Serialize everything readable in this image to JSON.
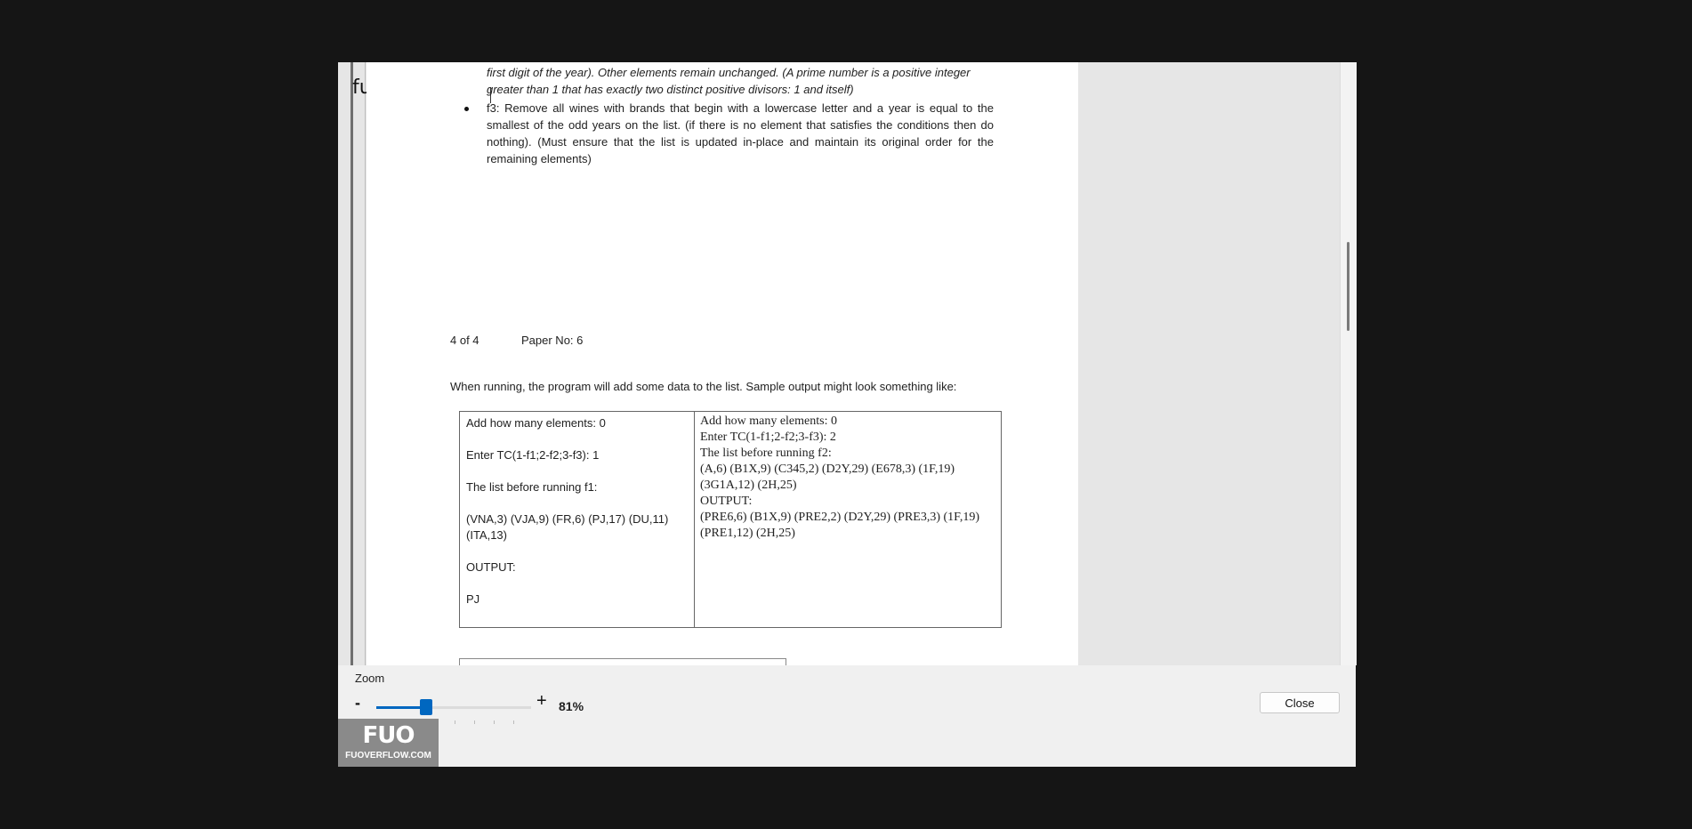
{
  "brand": {
    "watermark": "fuoverflow"
  },
  "document": {
    "italic_line_1": "first digit of the year). Other elements remain unchanged. (A prime number is a positive integer",
    "italic_line_2": "greater than 1 that has exactly two distinct positive divisors: 1 and itself)",
    "bullet_f3": "f3: Remove all wines with brands that begin with a lowercase letter and a year is equal to the smallest of the odd years on the list. (if there is no element that satisfies the conditions then do nothing). (Must ensure that the list is updated in-place and maintain its original order for the remaining elements)",
    "page_number": "4 of 4",
    "paper_no": "Paper No: 6",
    "running_text": "When running, the program will add  some data to the list. Sample output might look something like:",
    "sample_left": [
      "Add how many elements: 0",
      "Enter TC(1-f1;2-f2;3-f3): 1",
      "The list before running f1:",
      "(VNA,3) (VJA,9) (FR,6) (PJ,17) (DU,11) (ITA,13)",
      "OUTPUT:",
      "PJ"
    ],
    "sample_right": [
      "Add how many elements: 0",
      "Enter TC(1-f1;2-f2;3-f3): 2",
      "The list before running f2:",
      "(A,6) (B1X,9) (C345,2) (D2Y,29) (E678,3) (1F,19) (3G1A,12) (2H,25)",
      "OUTPUT:",
      "(PRE6,6) (B1X,9) (PRE2,2) (D2Y,29) (PRE3,3) (1F,19) (PRE1,12) (2H,25)"
    ]
  },
  "zoom": {
    "label": "Zoom",
    "minus": "-",
    "plus": "+",
    "value": "81%",
    "level_percent": 81
  },
  "buttons": {
    "close": "Close"
  },
  "badge": {
    "logo": "FUO",
    "url": "FUOVERFLOW.COM"
  }
}
